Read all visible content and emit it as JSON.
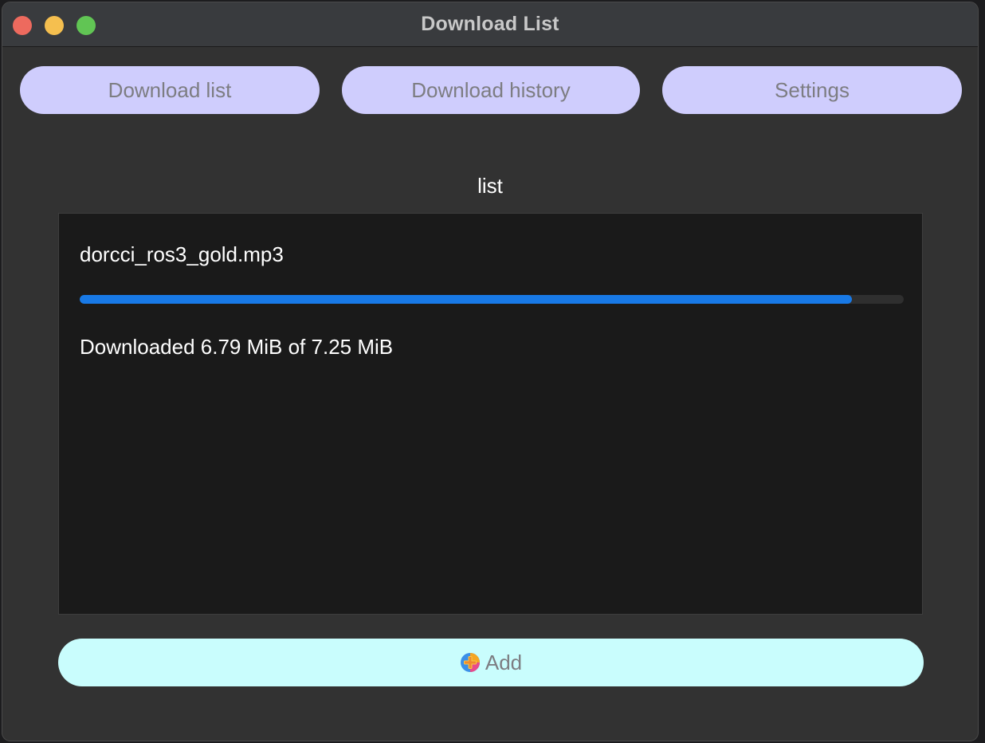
{
  "window": {
    "title": "Download List"
  },
  "tabs": [
    {
      "label": "Download list"
    },
    {
      "label": "Download history"
    },
    {
      "label": "Settings"
    }
  ],
  "list": {
    "heading": "list",
    "items": [
      {
        "filename": "dorcci_ros3_gold.mp3",
        "progress_percent": 93.7,
        "status": "Downloaded 6.79 MiB of 7.25 MiB"
      }
    ]
  },
  "add_button": {
    "label": "Add",
    "icon": "add-plus-icon"
  },
  "colors": {
    "tab_bg": "#cfcdfd",
    "add_bg": "#c9fdfd",
    "progress": "#1879e6",
    "window_bg": "#323232",
    "panel_bg": "#1a1a1a"
  }
}
